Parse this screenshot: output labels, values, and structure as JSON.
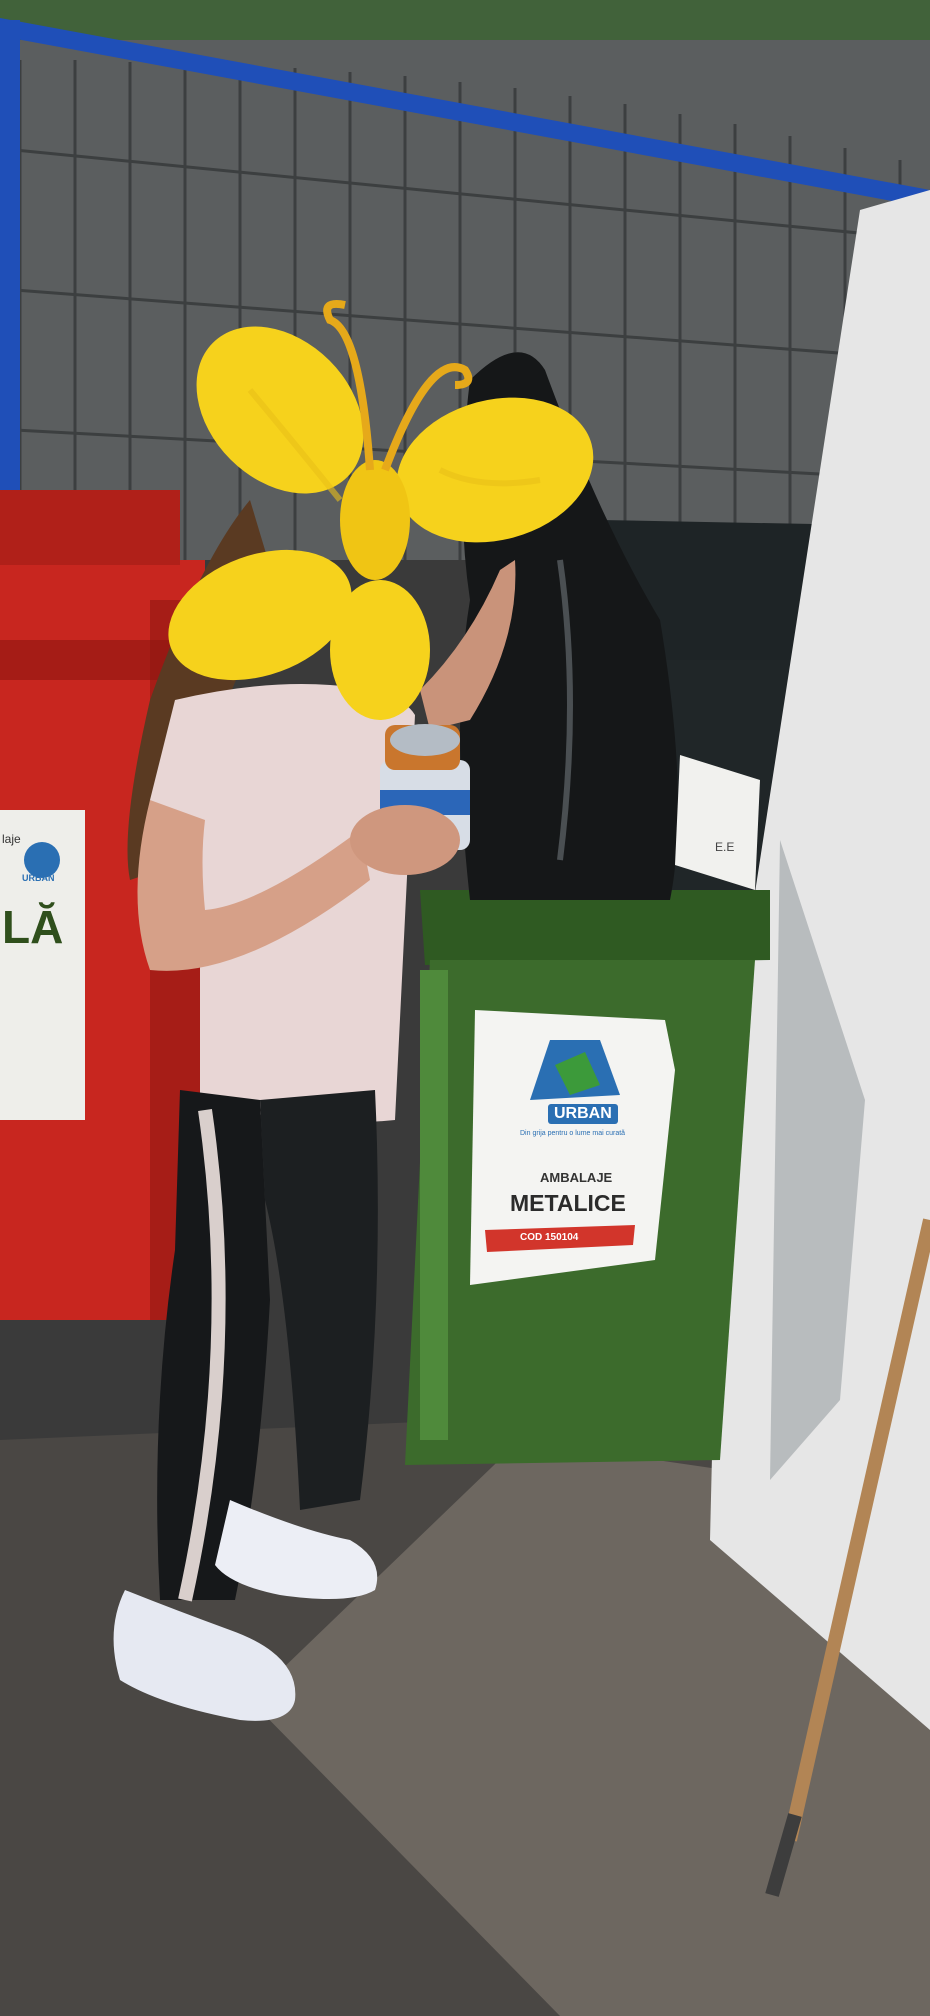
{
  "scene": {
    "description_free": true,
    "colors": {
      "fence_frame": "#1f4fb8",
      "bin_red": "#c8261f",
      "bin_green": "#3c6b2c",
      "bin_black": "#1e2426",
      "ground": "#4a4744",
      "wall": "#e6e6e6",
      "emoji": "#f6d21c"
    }
  },
  "green_bin_label": {
    "brand": "URBAN",
    "slogan": "Din grija pentru o lume mai curată",
    "line1": "AMBALAJE",
    "line2": "METALICE",
    "code": "COD 150104"
  },
  "red_bin_label": {
    "text1": "laje",
    "brand": "URBAN",
    "big": "LĂ"
  },
  "black_bin_label": {
    "text": "E.E"
  },
  "icons": {
    "emoji": "butterfly-emoji-icon",
    "recycle": "recycle-icon"
  }
}
